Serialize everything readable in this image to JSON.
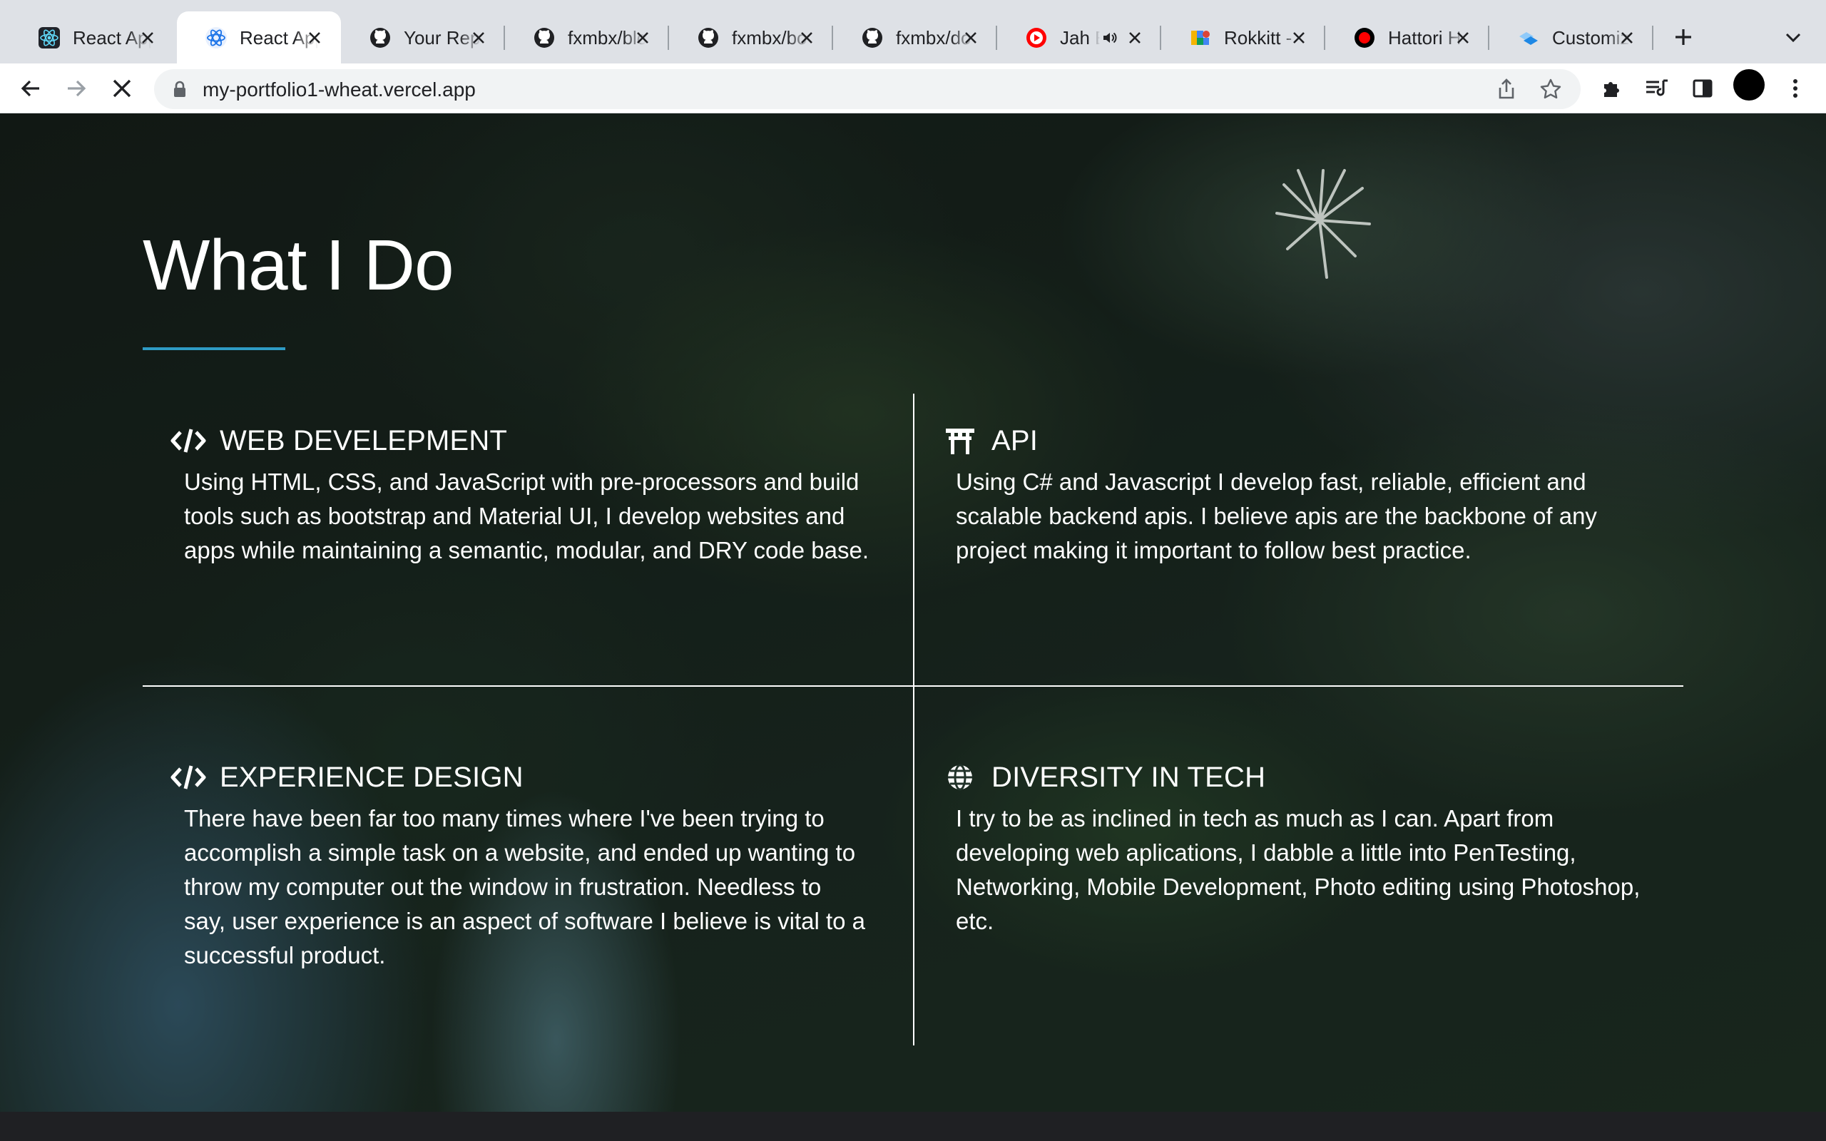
{
  "browser": {
    "tabs": [
      {
        "title": "React App",
        "favicon": "react-icon",
        "active": false
      },
      {
        "title": "React App",
        "favicon": "react-icon",
        "active": true
      },
      {
        "title": "Your Repositories",
        "favicon": "github-icon",
        "active": false
      },
      {
        "title": "fxmbx/blog",
        "favicon": "github-icon",
        "active": false
      },
      {
        "title": "fxmbx/bo",
        "favicon": "github-icon",
        "active": false
      },
      {
        "title": "fxmbx/do",
        "favicon": "github-icon",
        "active": false
      },
      {
        "title": "Jah E",
        "favicon": "youtube-icon",
        "active": false,
        "audio": true
      },
      {
        "title": "Rokkitt -",
        "favicon": "google-fonts-icon",
        "active": false
      },
      {
        "title": "Hattori H",
        "favicon": "record-icon",
        "active": false
      },
      {
        "title": "Customiz",
        "favicon": "mui-icon",
        "active": false
      }
    ],
    "url": "my-portfolio1-wheat.vercel.app"
  },
  "page": {
    "title": "What I Do",
    "accent_color": "#2e9bc4",
    "services": [
      {
        "icon": "code-icon",
        "title": "WEB DEVELEPMENT",
        "body": "Using HTML, CSS, and JavaScript with pre-processors and build tools such as bootstrap and Material UI, I develop websites and apps while maintaining a semantic, modular, and DRY code base."
      },
      {
        "icon": "torii-gate-icon",
        "title": "API",
        "body": "Using C# and Javascript I develop fast, reliable, efficient and scalable backend apis. I believe apis are the backbone of any project making it important to follow best practice."
      },
      {
        "icon": "code-icon",
        "title": "EXPERIENCE DESIGN",
        "body": "There have been far too many times where I've been trying to accomplish a simple task on a website, and ended up wanting to throw my computer out the window in frustration. Needless to say, user experience is an aspect of software I believe is vital to a successful product."
      },
      {
        "icon": "globe-icon",
        "title": "DIVERSITY IN TECH",
        "body": "I try to be as inclined in tech as much as I can. Apart from developing web aplications, I dabble a little into PenTesting, Networking, Mobile Development, Photo editing using Photoshop, etc."
      }
    ]
  }
}
